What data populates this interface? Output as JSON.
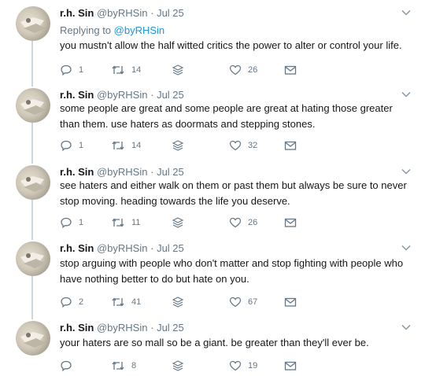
{
  "tweets": [
    {
      "name": "r.h. Sin",
      "handle": "@byRHSin",
      "dot": "·",
      "time": "Jul 25",
      "replying_label": "Replying to",
      "replying_mention": "@byRHSin",
      "text": "you mustn't allow the half witted critics the power to alter or control your life.",
      "replies": "1",
      "retweets": "14",
      "likes": "26"
    },
    {
      "name": "r.h. Sin",
      "handle": "@byRHSin",
      "dot": "·",
      "time": "Jul 25",
      "text": "some people are great and some people are great at hating those greater than them. use haters as doormats and stepping stones.",
      "replies": "1",
      "retweets": "14",
      "likes": "32"
    },
    {
      "name": "r.h. Sin",
      "handle": "@byRHSin",
      "dot": "·",
      "time": "Jul 25",
      "text": "see haters and either walk on them or past them but always be sure to never stop moving. heading towards the life you deserve.",
      "replies": "1",
      "retweets": "11",
      "likes": "26"
    },
    {
      "name": "r.h. Sin",
      "handle": "@byRHSin",
      "dot": "·",
      "time": "Jul 25",
      "text": "stop arguing with people who don't matter and stop fighting with people who have nothing better to do but hate on you.",
      "replies": "2",
      "retweets": "41",
      "likes": "67"
    },
    {
      "name": "r.h. Sin",
      "handle": "@byRHSin",
      "dot": "·",
      "time": "Jul 25",
      "text": "your haters are so mall so be a giant. be greater than they'll ever be.",
      "replies": "",
      "retweets": "8",
      "likes": "19"
    }
  ],
  "icons": {
    "reply": "reply-icon",
    "retweet": "retweet-icon",
    "stack": "layers-icon",
    "like": "heart-icon",
    "message": "envelope-icon",
    "caret": "chevron-down-icon"
  },
  "colors": {
    "text": "#14171a",
    "muted": "#657786",
    "link": "#1b95e0",
    "thread_line": "#ccd6dd"
  }
}
